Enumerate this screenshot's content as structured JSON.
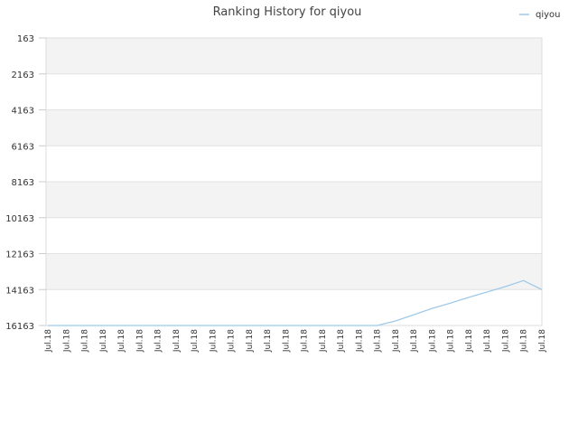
{
  "chart_data": {
    "type": "line",
    "title": "Ranking History for qiyou",
    "xlabel": "",
    "ylabel": "",
    "y_inverted": true,
    "ylim": [
      163,
      16163
    ],
    "y_ticks": [
      163,
      2163,
      4163,
      6163,
      8163,
      10163,
      12163,
      14163,
      16163
    ],
    "y_tick_labels": [
      "163",
      "2163",
      "4163",
      "6163",
      "8163",
      "10163",
      "12163",
      "14163",
      "16163"
    ],
    "x": [
      "Jul.18",
      "Jul.18",
      "Jul.18",
      "Jul.18",
      "Jul.18",
      "Jul.18",
      "Jul.18",
      "Jul.18",
      "Jul.18",
      "Jul.18",
      "Jul.18",
      "Jul.18",
      "Jul.18",
      "Jul.18",
      "Jul.18",
      "Jul.18",
      "Jul.18",
      "Jul.18",
      "Jul.18",
      "Jul.18",
      "Jul.18",
      "Jul.18",
      "Jul.18",
      "Jul.18",
      "Jul.18",
      "Jul.18",
      "Jul.18",
      "Jul.18"
    ],
    "series": [
      {
        "name": "qiyou",
        "color": "#9ecae9",
        "values": [
          16163,
          16163,
          16163,
          16163,
          16163,
          16163,
          16163,
          16163,
          16163,
          16163,
          16163,
          16163,
          16163,
          16163,
          16163,
          16163,
          16163,
          16163,
          16163,
          15913,
          15563,
          15213,
          14913,
          14600,
          14300,
          14000,
          13663,
          14163
        ]
      }
    ],
    "grid": true,
    "band_colors": [
      "#f3f3f3",
      "#ffffff"
    ],
    "legend": "top-right"
  }
}
